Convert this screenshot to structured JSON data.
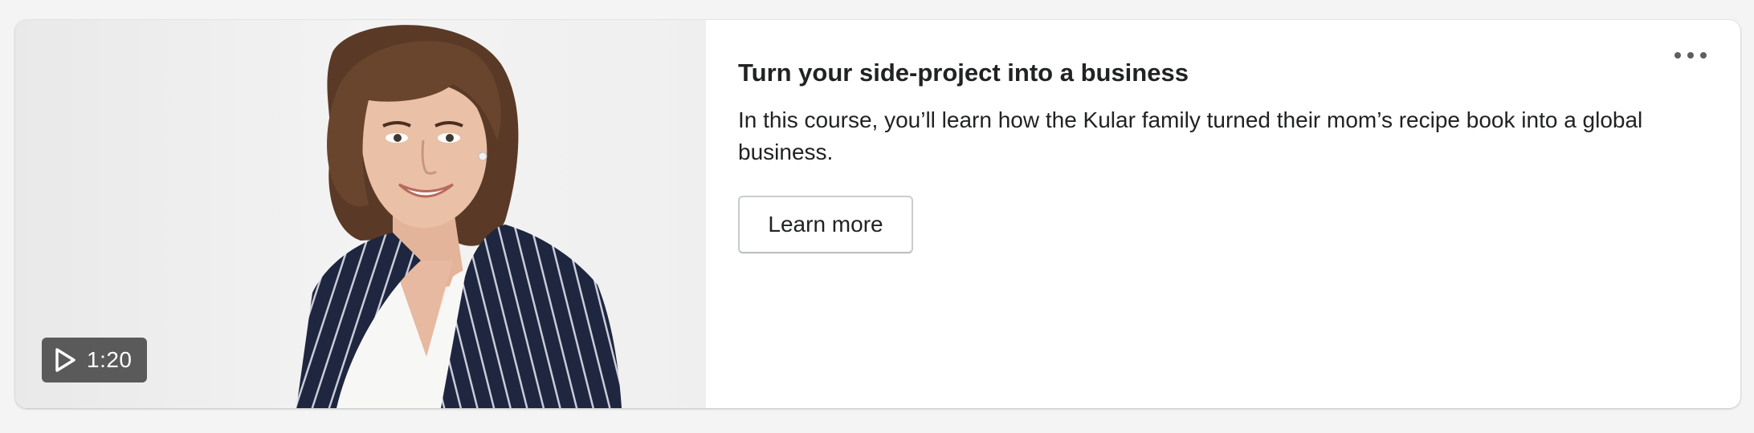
{
  "card": {
    "title": "Turn your side-project into a business",
    "description": "In this course, you’ll learn how the Kular family turned their mom’s recipe book into a global business.",
    "button_label": "Learn more",
    "more_actions_icon": "horizontal-dots-icon"
  },
  "video": {
    "duration": "1:20",
    "play_icon": "play-icon",
    "thumbnail": "presenter-portrait"
  },
  "colors": {
    "page_background": "#f4f4f4",
    "card_background": "#ffffff",
    "text_primary": "#202223",
    "badge_background": "#464646",
    "button_border": "#c9cccf"
  }
}
